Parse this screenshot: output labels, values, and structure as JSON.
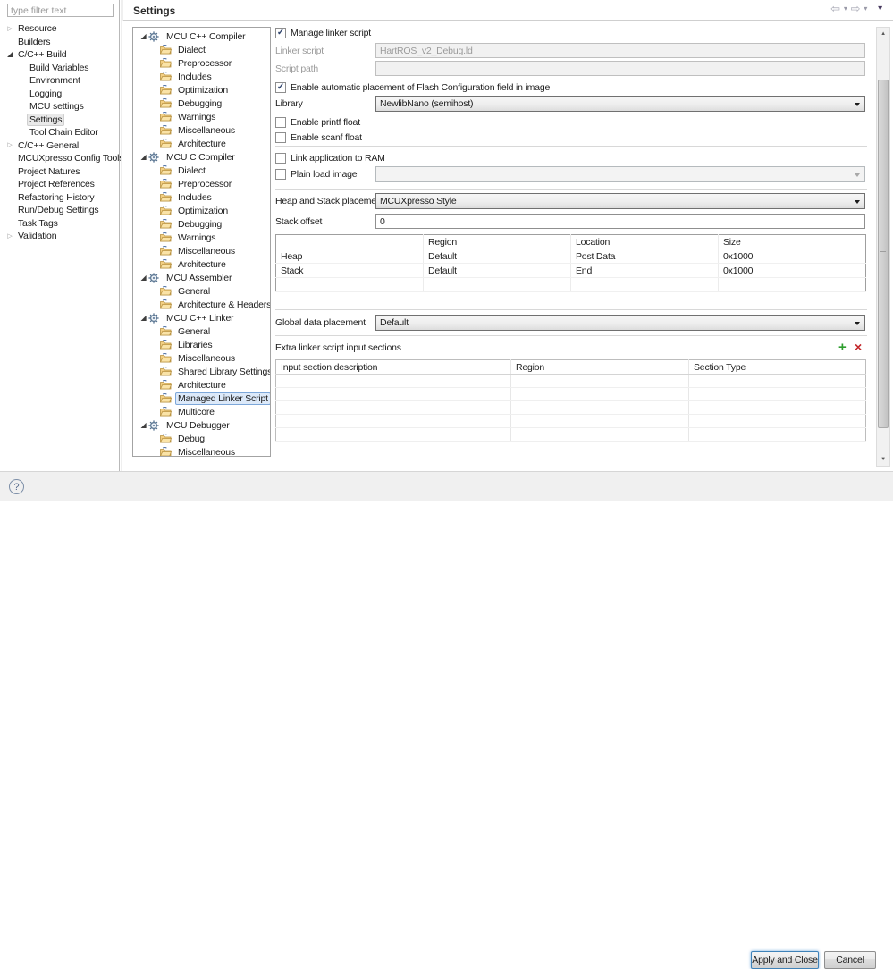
{
  "window": {
    "title": "Settings",
    "filter_placeholder": "type filter text",
    "help_icon": "?",
    "buttons": {
      "apply": "Apply and Close",
      "cancel": "Cancel"
    },
    "toolbar": {
      "back_icon": "⇦",
      "forward_icon": "⇨",
      "dropdown_icon": "▾",
      "view_menu_icon": "▾"
    }
  },
  "icons": {
    "collapsed": "▷",
    "expanded": "◢",
    "check": "✓",
    "add": "+",
    "delete": "×",
    "scroll_up": "▲",
    "scroll_down": "▼"
  },
  "colors": {
    "selection_bg": "#dce9f9",
    "selection_border": "#7da7d9",
    "add_green": "#2e9e2e",
    "delete_red": "#c3262a"
  },
  "preference_tree": {
    "items": [
      {
        "label": "Resource",
        "level": 0,
        "twisty": "collapsed"
      },
      {
        "label": "Builders",
        "level": 0,
        "twisty": "none"
      },
      {
        "label": "C/C++ Build",
        "level": 0,
        "twisty": "expanded"
      },
      {
        "label": "Build Variables",
        "level": 1,
        "twisty": "none"
      },
      {
        "label": "Environment",
        "level": 1,
        "twisty": "none"
      },
      {
        "label": "Logging",
        "level": 1,
        "twisty": "none"
      },
      {
        "label": "MCU settings",
        "level": 1,
        "twisty": "none"
      },
      {
        "label": "Settings",
        "level": 1,
        "twisty": "none",
        "selected": true
      },
      {
        "label": "Tool Chain Editor",
        "level": 1,
        "twisty": "none"
      },
      {
        "label": "C/C++ General",
        "level": 0,
        "twisty": "collapsed"
      },
      {
        "label": "MCUXpresso Config Tools",
        "level": 0,
        "twisty": "none"
      },
      {
        "label": "Project Natures",
        "level": 0,
        "twisty": "none"
      },
      {
        "label": "Project References",
        "level": 0,
        "twisty": "none"
      },
      {
        "label": "Refactoring History",
        "level": 0,
        "twisty": "none"
      },
      {
        "label": "Run/Debug Settings",
        "level": 0,
        "twisty": "none"
      },
      {
        "label": "Task Tags",
        "level": 0,
        "twisty": "none"
      },
      {
        "label": "Validation",
        "level": 0,
        "twisty": "collapsed"
      }
    ]
  },
  "tool_tree": {
    "items": [
      {
        "label": "MCU C++ Compiler",
        "type": "category"
      },
      {
        "label": "Dialect",
        "type": "page"
      },
      {
        "label": "Preprocessor",
        "type": "page"
      },
      {
        "label": "Includes",
        "type": "page"
      },
      {
        "label": "Optimization",
        "type": "page"
      },
      {
        "label": "Debugging",
        "type": "page"
      },
      {
        "label": "Warnings",
        "type": "page"
      },
      {
        "label": "Miscellaneous",
        "type": "page"
      },
      {
        "label": "Architecture",
        "type": "page"
      },
      {
        "label": "MCU C Compiler",
        "type": "category"
      },
      {
        "label": "Dialect",
        "type": "page"
      },
      {
        "label": "Preprocessor",
        "type": "page"
      },
      {
        "label": "Includes",
        "type": "page"
      },
      {
        "label": "Optimization",
        "type": "page"
      },
      {
        "label": "Debugging",
        "type": "page"
      },
      {
        "label": "Warnings",
        "type": "page"
      },
      {
        "label": "Miscellaneous",
        "type": "page"
      },
      {
        "label": "Architecture",
        "type": "page"
      },
      {
        "label": "MCU Assembler",
        "type": "category"
      },
      {
        "label": "General",
        "type": "page"
      },
      {
        "label": "Architecture & Headers",
        "type": "page"
      },
      {
        "label": "MCU C++ Linker",
        "type": "category"
      },
      {
        "label": "General",
        "type": "page"
      },
      {
        "label": "Libraries",
        "type": "page"
      },
      {
        "label": "Miscellaneous",
        "type": "page"
      },
      {
        "label": "Shared Library Settings",
        "type": "page"
      },
      {
        "label": "Architecture",
        "type": "page"
      },
      {
        "label": "Managed Linker Script",
        "type": "page",
        "selected": true
      },
      {
        "label": "Multicore",
        "type": "page"
      },
      {
        "label": "MCU Debugger",
        "type": "category"
      },
      {
        "label": "Debug",
        "type": "page"
      },
      {
        "label": "Miscellaneous",
        "type": "page"
      }
    ]
  },
  "linker_page": {
    "manage_linker_script": {
      "label": "Manage linker script",
      "checked": true
    },
    "linker_script": {
      "label": "Linker script",
      "value": "HartROS_v2_Debug.ld",
      "disabled": true
    },
    "script_path": {
      "label": "Script path",
      "value": "",
      "disabled": true
    },
    "flash_config": {
      "label": "Enable automatic placement of Flash Configuration field in image",
      "checked": true
    },
    "library": {
      "label": "Library",
      "value": "NewlibNano (semihost)"
    },
    "printf_float": {
      "label": "Enable printf float",
      "checked": false
    },
    "scanf_float": {
      "label": "Enable scanf float",
      "checked": false
    },
    "link_to_ram": {
      "label": "Link application to RAM",
      "checked": false
    },
    "plain_load_image": {
      "label": "Plain load image",
      "checked": false,
      "value": "",
      "disabled": true
    },
    "heap_stack_placement": {
      "label": "Heap and Stack placement",
      "value": "MCUXpresso Style"
    },
    "stack_offset": {
      "label": "Stack offset",
      "value": "0"
    },
    "heap_stack_table": {
      "headers": [
        "",
        "Region",
        "Location",
        "Size"
      ],
      "rows": [
        [
          "Heap",
          "Default",
          "Post Data",
          "0x1000"
        ],
        [
          "Stack",
          "Default",
          "End",
          "0x1000"
        ],
        [
          "",
          "",
          "",
          ""
        ]
      ]
    },
    "global_data_placement": {
      "label": "Global data placement",
      "value": "Default"
    },
    "extra_sections": {
      "label": "Extra linker script input sections",
      "headers": [
        "Input section description",
        "Region",
        "Section Type"
      ],
      "rows": [
        [
          "",
          "",
          ""
        ],
        [
          "",
          "",
          ""
        ],
        [
          "",
          "",
          ""
        ],
        [
          "",
          "",
          ""
        ],
        [
          "",
          "",
          ""
        ]
      ]
    }
  }
}
